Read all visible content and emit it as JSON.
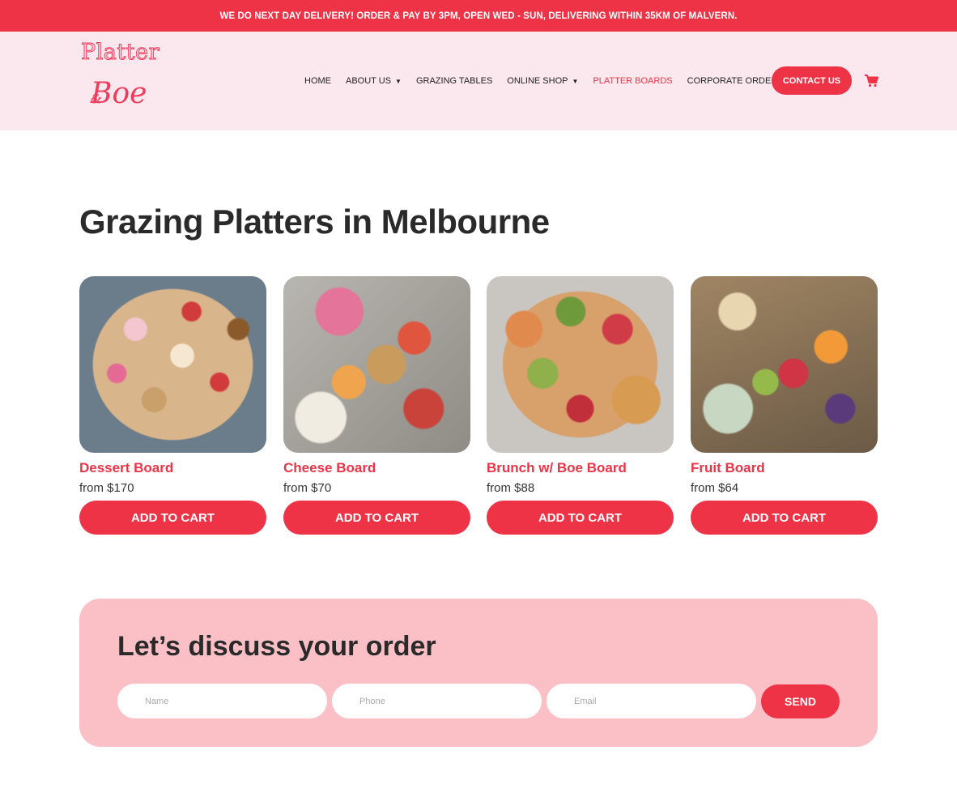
{
  "announcement": "WE DO NEXT DAY DELIVERY! ORDER & PAY BY 3PM, OPEN WED - SUN, DELIVERING WITHIN 35KM OF MALVERN.",
  "logo": {
    "line1": "Platter",
    "amp": "&",
    "line2": "Boe"
  },
  "nav": {
    "items": [
      {
        "label": "HOME",
        "has_dropdown": false,
        "active": false
      },
      {
        "label": "ABOUT US",
        "has_dropdown": true,
        "active": false
      },
      {
        "label": "GRAZING TABLES",
        "has_dropdown": false,
        "active": false
      },
      {
        "label": "ONLINE SHOP",
        "has_dropdown": true,
        "active": false
      },
      {
        "label": "PLATTER BOARDS",
        "has_dropdown": false,
        "active": true
      },
      {
        "label": "CORPORATE ORDERS",
        "has_dropdown": false,
        "active": false
      }
    ],
    "contact_label": "CONTACT US",
    "cart_icon": "shopping-cart-icon"
  },
  "page_title": "Grazing Platters in Melbourne",
  "products": [
    {
      "name": "Dessert Board",
      "price": "from $170",
      "button": "ADD TO CART",
      "image": "dessert-board-photo"
    },
    {
      "name": "Cheese Board",
      "price": "from $70",
      "button": "ADD TO CART",
      "image": "cheese-board-photo"
    },
    {
      "name": "Brunch w/ Boe Board",
      "price": "from $88",
      "button": "ADD TO CART",
      "image": "brunch-board-photo"
    },
    {
      "name": "Fruit Board",
      "price": "from $64",
      "button": "ADD TO CART",
      "image": "fruit-board-photo"
    }
  ],
  "contact_form": {
    "title": "Let’s discuss your order",
    "name_placeholder": "Name",
    "phone_placeholder": "Phone",
    "email_placeholder": "Email",
    "send_label": "SEND"
  },
  "colors": {
    "brand_red": "#ee3346",
    "header_bg": "#fbe8ee",
    "form_bg": "#fbbfc6"
  }
}
